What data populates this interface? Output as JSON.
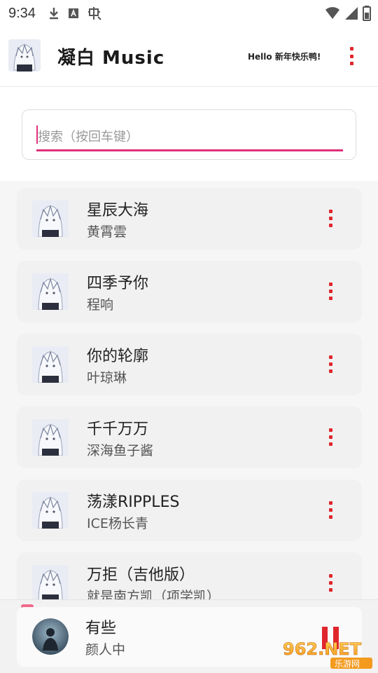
{
  "status_bar": {
    "time": "9:34",
    "icons": [
      "download-icon",
      "font-a-icon",
      "bug-icon",
      "wifi-icon",
      "signal-icon",
      "battery-icon"
    ]
  },
  "app_bar": {
    "title": "凝白 Music",
    "greeting": "Hello 新年快乐鸭!",
    "menu_icon": "more-vert-icon"
  },
  "search": {
    "placeholder": "搜索（按回车键）",
    "value": ""
  },
  "songs": [
    {
      "title": "星辰大海",
      "artist": "黄霄雲"
    },
    {
      "title": "四季予你",
      "artist": "程响"
    },
    {
      "title": "你的轮廓",
      "artist": "叶琼琳"
    },
    {
      "title": "千千万万",
      "artist": "深海鱼子酱"
    },
    {
      "title": "荡漾RIPPLES",
      "artist": "ICE杨长青"
    },
    {
      "title": "万拒（吉他版）",
      "artist": "就是南方凯（项学凯）"
    }
  ],
  "player": {
    "title": "有些",
    "artist": "颜人中",
    "state_icon": "pause-icon"
  },
  "watermark": {
    "text": "962.NET",
    "subtext": "乐游网"
  },
  "colors": {
    "accent_red": "#e0262d",
    "accent_pink": "#e0307a",
    "list_bg": "#f6f6f6",
    "card_bg": "#f1f1f1"
  }
}
